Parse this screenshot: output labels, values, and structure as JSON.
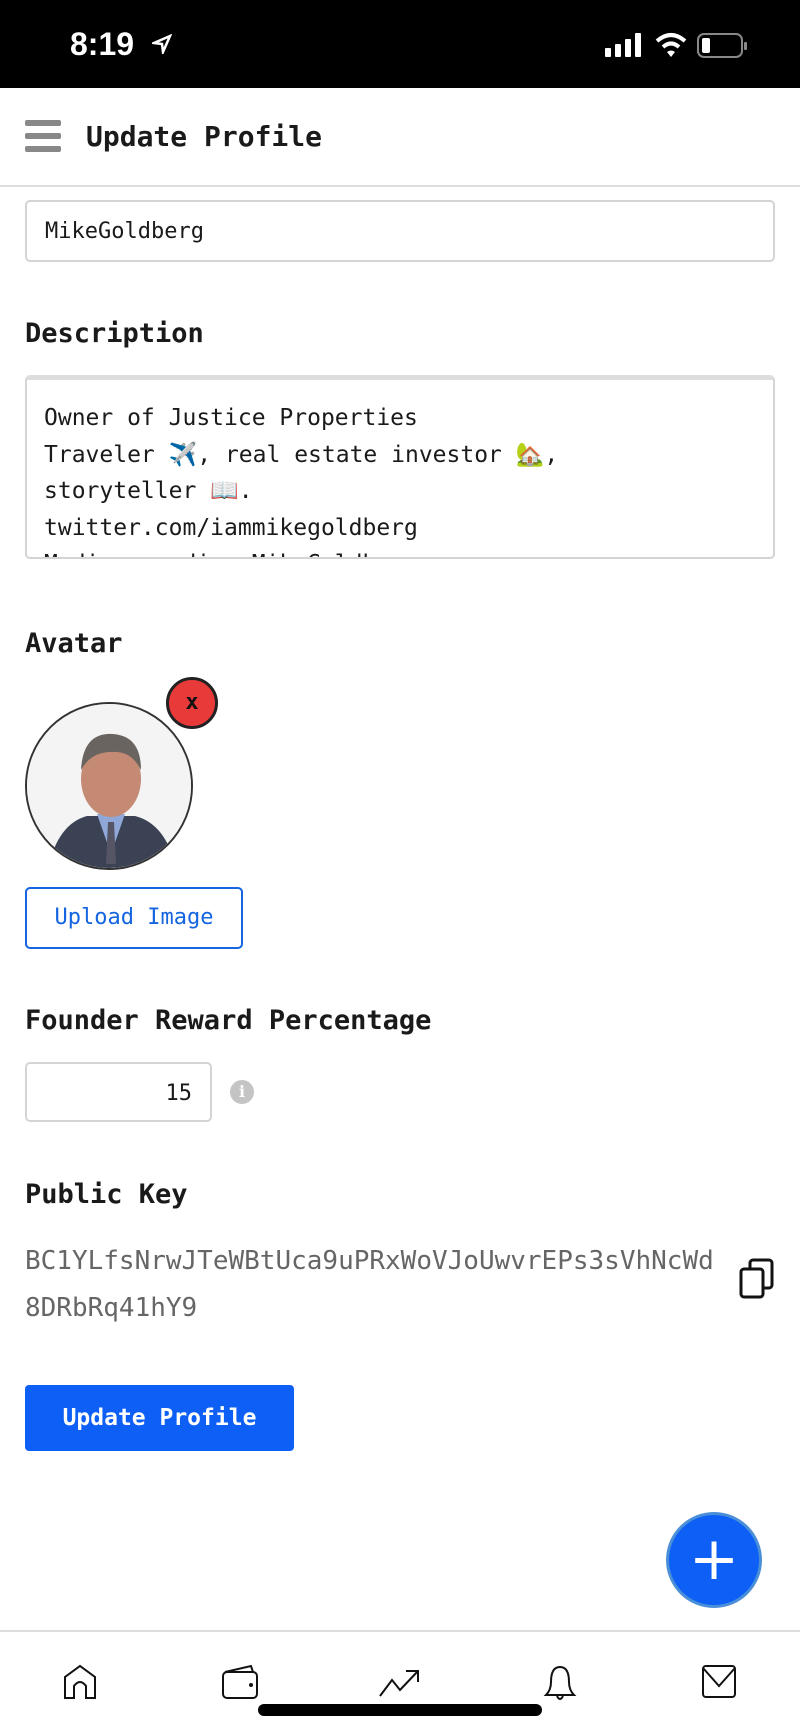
{
  "status_bar": {
    "time": "8:19"
  },
  "header": {
    "title": "Update Profile"
  },
  "form": {
    "username_value": "MikeGoldberg",
    "description_label": "Description",
    "description_value": "Owner of Justice Properties\nTraveler ✈️, real estate investor 🏡,\nstoryteller 📖.\ntwitter.com/iammikegoldberg\nMedium: medium.MikeGoldberg.com",
    "avatar_label": "Avatar",
    "remove_avatar_label": "x",
    "upload_label": "Upload Image",
    "founder_reward_label": "Founder Reward Percentage",
    "founder_reward_value": "15",
    "public_key_label": "Public Key",
    "public_key_value": "BC1YLfsNrwJTeWBtUca9uPRxWoVJoUwvrEPs3sVhNcWd8DRbRq41hY9",
    "submit_label": "Update Profile"
  },
  "fab": {
    "label": "+"
  },
  "bottom_nav": [
    "home-icon",
    "wallet-icon",
    "trending-icon",
    "bell-icon",
    "mail-icon"
  ],
  "colors": {
    "accent": "#0d5ff5",
    "danger": "#e93a3a"
  }
}
